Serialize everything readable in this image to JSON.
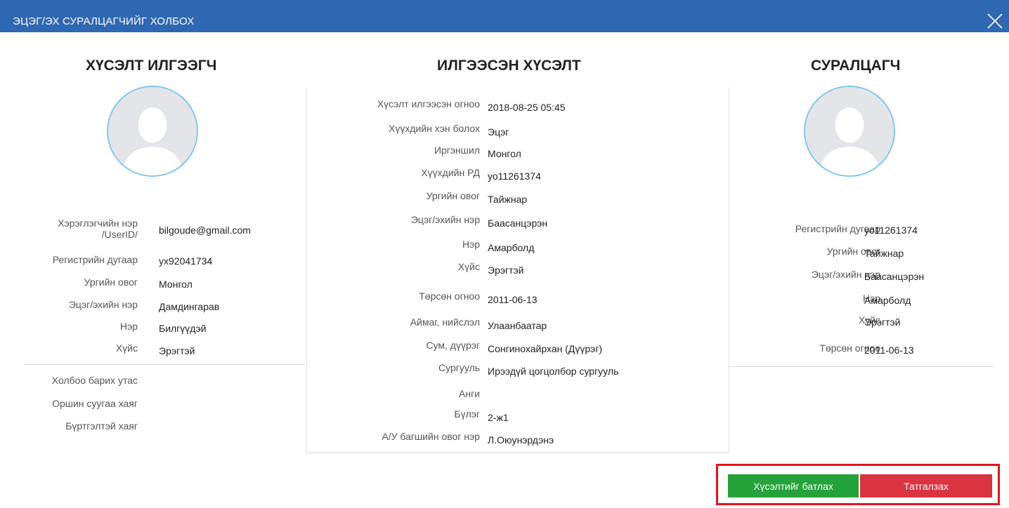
{
  "window": {
    "title": "ЭЦЭГ/ЭХ СУРАЛЦАГЧИЙГ ХОЛБОХ",
    "title_bar_color": "#2f68b2"
  },
  "requester": {
    "heading": "ХҮСЭЛТ ИЛГЭЭГЧ",
    "fields": [
      {
        "label": "Хэрэглэгчийн нэр",
        "label2": "/UserID/",
        "value": "bilgoude@gmail.com"
      },
      {
        "label": "Регистрийн дугаар",
        "value": "ух92041734"
      },
      {
        "label": "Ургийн овог",
        "value": "Монгол"
      },
      {
        "label": "Эцэг/эхийн нэр",
        "value": "Дамдингарав"
      },
      {
        "label": "Нэр",
        "value": "Билгүүдэй"
      },
      {
        "label": "Хүйс",
        "value": "Эрэгтэй"
      }
    ],
    "contact": [
      {
        "label": "Холбоо барих утас",
        "value": ""
      },
      {
        "label": "Оршин суугаа хаяг",
        "value": ""
      },
      {
        "label": "Бүртгэлтэй хаяг",
        "value": ""
      }
    ]
  },
  "request": {
    "heading": "ИЛГЭЭСЭН ХҮСЭЛТ",
    "fields": [
      {
        "label": "Хүсэлт илгээсэн огноо",
        "value": "2018-08-25 05:45"
      },
      {
        "label": "Хүүхдийн хэн болох",
        "value": "Эцэг"
      },
      {
        "label": "Иргэншил",
        "value": "Монгол"
      },
      {
        "label": "Хүүхдийн РД",
        "value": "уо11261374"
      },
      {
        "label": "Ургийн овог",
        "value": "Тайжнар"
      },
      {
        "label": "Эцэг/эхийн нэр",
        "value": "Баасанцэрэн"
      },
      {
        "label": "Нэр",
        "value": "Амарболд"
      },
      {
        "label": "Хүйс",
        "value": "Эрэгтэй"
      },
      {
        "label": "Төрсөн огноо",
        "value": "2011-06-13"
      },
      {
        "label": "Аймаг, нийслэл",
        "value": "Улаанбаатар"
      },
      {
        "label": "Сум, дүүрэг",
        "value": "Сонгинохайрхан (Дүүрэг)"
      },
      {
        "label": "Сургууль",
        "value": "Ирээдүй цогцолбор сургууль"
      },
      {
        "label": "Анги",
        "value": ""
      },
      {
        "label": "Бүлэг",
        "value": "2-ж1"
      },
      {
        "label": "А/У багшийн овог нэр",
        "value": "Л.Оюунэрдэнэ"
      }
    ]
  },
  "student": {
    "heading": "СУРАЛЦАГЧ",
    "fields": [
      {
        "label": "Регистрийн дугаар",
        "value": "уо11261374"
      },
      {
        "label": "Ургийн овог",
        "value": "Тайжнар"
      },
      {
        "label": "Эцэг/эхийн нэр",
        "value": "Баасанцэрэн"
      },
      {
        "label": "Нэр",
        "value": "Амарболд"
      },
      {
        "label": "Хүйс",
        "value": "Эрэгтэй"
      },
      {
        "label": "Төрсөн огноо",
        "value": "2011-06-13"
      }
    ]
  },
  "actions": {
    "approve_label": "Хүсэлтийг батлах",
    "reject_label": "Татгалзах",
    "approve_color": "#24a33a",
    "reject_color": "#d9343f",
    "highlight_color": "#e5131b"
  },
  "icons": {
    "close": "close-icon",
    "avatar": "user-avatar-icon"
  }
}
